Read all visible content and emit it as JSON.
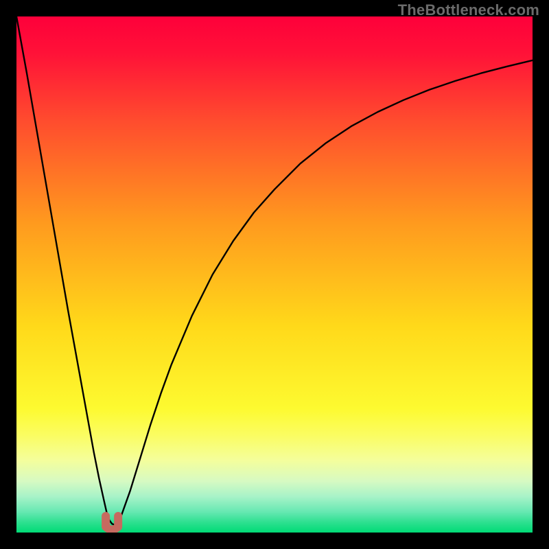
{
  "watermark": {
    "text": "TheBottleneck.com"
  },
  "chart_data": {
    "type": "line",
    "title": "",
    "xlabel": "",
    "ylabel": "",
    "xlim": [
      0,
      100
    ],
    "ylim": [
      0,
      100
    ],
    "grid": false,
    "legend": false,
    "x": [
      0,
      2,
      4,
      6,
      8,
      10,
      12,
      14,
      15,
      16,
      17,
      17.5,
      18,
      18.5,
      19,
      19.5,
      20,
      22,
      24,
      26,
      28,
      30,
      34,
      38,
      42,
      46,
      50,
      55,
      60,
      65,
      70,
      75,
      80,
      85,
      90,
      95,
      100
    ],
    "values": [
      100,
      89,
      77.5,
      66,
      54.5,
      43,
      32,
      21,
      15.5,
      10.5,
      6,
      3.8,
      2.4,
      1.7,
      1.5,
      1.7,
      2.4,
      8,
      14.5,
      21,
      27,
      32.5,
      42,
      50,
      56.5,
      62,
      66.5,
      71.5,
      75.5,
      78.8,
      81.5,
      83.8,
      85.8,
      87.5,
      89,
      90.3,
      91.5
    ],
    "marker": {
      "x": 18.5,
      "width": 2.4,
      "height": 3.2,
      "color": "#c66a5f"
    },
    "background_gradient": [
      {
        "pct": 0,
        "color": "#fe003a"
      },
      {
        "pct": 7,
        "color": "#ff1138"
      },
      {
        "pct": 20,
        "color": "#ff4b2e"
      },
      {
        "pct": 40,
        "color": "#ff9a1e"
      },
      {
        "pct": 60,
        "color": "#ffd91a"
      },
      {
        "pct": 76,
        "color": "#fdfa30"
      },
      {
        "pct": 81,
        "color": "#fbfd60"
      },
      {
        "pct": 86,
        "color": "#f4fe9c"
      },
      {
        "pct": 90,
        "color": "#d7fac2"
      },
      {
        "pct": 93,
        "color": "#a8f3c8"
      },
      {
        "pct": 96,
        "color": "#66e8b2"
      },
      {
        "pct": 98,
        "color": "#2ee090"
      },
      {
        "pct": 100,
        "color": "#00db76"
      }
    ]
  }
}
